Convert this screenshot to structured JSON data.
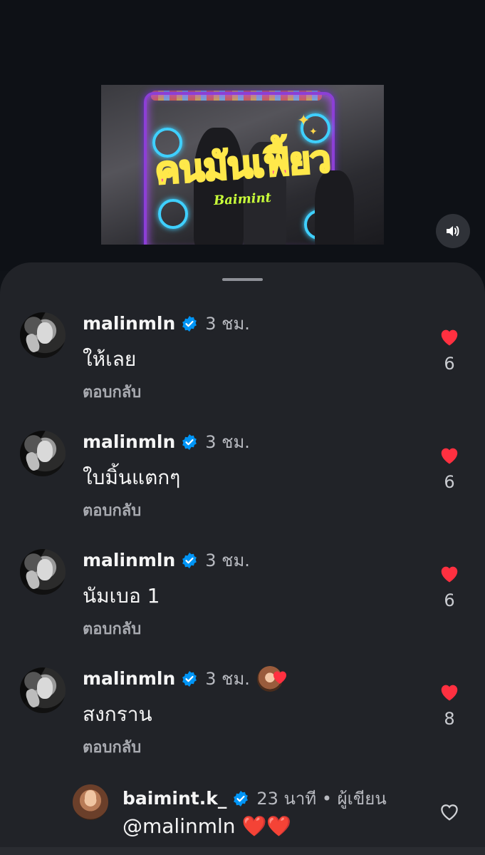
{
  "video": {
    "thumbnail_title": "คนมันเฟี้ยว",
    "thumbnail_subtitle": "Baimint"
  },
  "comments": [
    {
      "username": "malinmln",
      "time": "3 ชม.",
      "text": "ให้เลย",
      "reply_label": "ตอบกลับ",
      "likes": "6",
      "liked": true
    },
    {
      "username": "malinmln",
      "time": "3 ชม.",
      "text": "ใบมิ้นแตกๆ",
      "reply_label": "ตอบกลับ",
      "likes": "6",
      "liked": true
    },
    {
      "username": "malinmln",
      "time": "3 ชม.",
      "text": "นัมเบอ 1",
      "reply_label": "ตอบกลับ",
      "likes": "6",
      "liked": true
    },
    {
      "username": "malinmln",
      "time": "3 ชม.",
      "text": "สงกราน",
      "reply_label": "ตอบกลับ",
      "likes": "8",
      "liked": true
    }
  ],
  "reply": {
    "username": "baimint.k_",
    "time": "23 นาที • ผู้เขียน",
    "text": "@malinmln ❤️❤️",
    "liked": false
  },
  "colors": {
    "sheet_bg": "#212328",
    "page_bg": "#0f1217",
    "like_red": "#ff3040",
    "verified_blue": "#0095f6"
  },
  "icons": {
    "sound": "speaker-icon",
    "verified": "verified-badge-icon",
    "like": "heart-icon"
  }
}
